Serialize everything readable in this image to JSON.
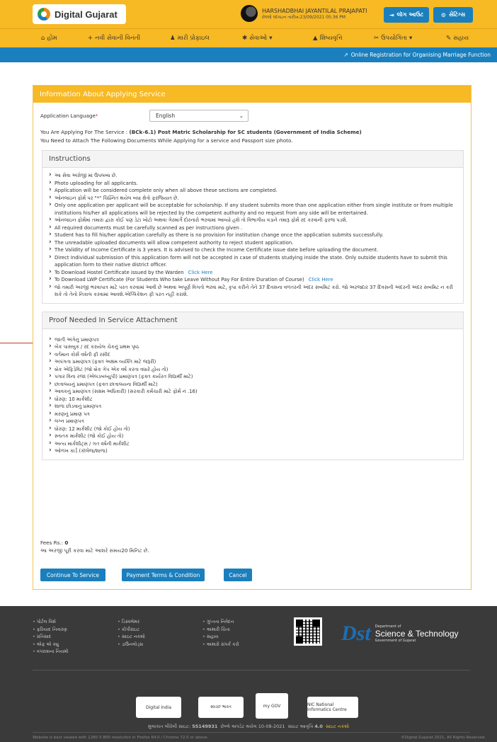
{
  "header": {
    "brand": "Digital Gujarat",
    "user_name": "HARSHADBHAI JAYANTILAL PRAJAPATI",
    "last_login": "છેલ્લો લૉગઇન તારીખ:23/09/2021 05:36 PM",
    "logout_label": "લૉગ આઉટ",
    "settings_label": "સેટિંગ્સ"
  },
  "nav": {
    "home": "હોમ",
    "new_request": "નવી સેવાની વિનંતી",
    "profile": "મારી પ્રોફાઇલ",
    "services": "સેવાઓ",
    "scholarship": "શિષ્યવૃત્તિ",
    "utility": "ઉપયોગિતા",
    "help": "સહાય"
  },
  "bluebar": {
    "link": "Online Registration for Organising Marriage Function"
  },
  "panel": {
    "title": "Information About Applying Service",
    "language_label": "Application Language",
    "language_value": "English",
    "service_prefix": "You Are Applying For The Service : ",
    "service_name": "(BCk-6.1) Post Matric Scholarship for SC students (Government of India Scheme)",
    "attach_note": "You Need to Attach The Following Documents While Applying for a service and Passport size photo."
  },
  "instructions": {
    "title": "Instructions",
    "items": [
      "આ સેવા અંગ્રેજી માં ઉપલબ્ધ છે.",
      "Photo uploading for all applicants.",
      "Application will be considered complete only when all above these sections are completed.",
      "ઓનલાઇન ફોર્મ પર \"*\" ચિહ્નિત થયેલ બધા ક્ષેત્રો ફરજિયાત છે.",
      "Only one application per applicant will be acceptable for scholarship. If any student submits more than one application either from single institute or from multiple institutions his/her all applications will be rejected by the competent authority and no request from any side will be entertained.",
      "ઓનલાઇન ફોર્મમાં તમારા દ્વારા કોઈ પણ ડેટા ખોટો અથવા ગેરમાર્ગે દોરનારો ભરવામાં આવ્યો હશે તો વિભાગીય વડાને તમારૂ ફોર્મ રદ કરવાની ફરજ પડશે.",
      "All required documents must be carefully scanned as per instructions given .",
      "Student has to fill his/her application carefully as there is no provision for institution change once the application submits successfully.",
      "The unreadable uploaded documents will allow competent authority to reject student application.",
      "The Validity of Income Certificate is 3 years. It is advised to check the Income Certificate issue date before uploading the document.",
      "Direct Individual submission of this application form will not be accepted in case of students studying inside the state. Only outside students have to submit this application form to their native district officer."
    ],
    "hostel_text": "To Download Hostel Certificate issued by the Warden",
    "hostel_link": "Click Here",
    "lwp_text": "To Download LWP Certificate (For Students Who take Leave Without Pay For Entire Duration of Course)",
    "lwp_link": "Click Here",
    "last_item": "જો તમારી અરજી ભરવાપાત્ર માટે પરત કરવામાં આવી છે અથવા અપૂર્ણ વિગતો ભરવા માટે, કૃપા કરીને તેને 37 દિવસના વળતરની અંદર સબમિટ કરો. જો અરજદાર 37 દિવસની અંદરની અંદર સબમિટ ન કરી શકે તો તેનો નિકાલ કરવામાં આવશે.એપ્લિકેશન ફી પરત નહીં કરાશે."
  },
  "proof": {
    "title": "Proof Needed In Service Attachment",
    "items": [
      "જાતી અંગેનુ પ્રમાણપત્ર",
      "બેંક પાસબુક / રદ કરાયેલ ચેકનું પ્રથમ પૃષ્ઠ",
      "વર્તમાન કોર્સ વર્ષની ફી રસીદ",
      "અપંગતા પ્રમાણપત્ર (ફક્ત અક્ષમ વ્યક્તિ માટે જરૂરી)",
      "બ્રેક એફિડેવિટ (જો બ્રેક ગેપ એક વર્ષ કરતા વધારે હોય તો)",
      "પગાર વિના રજા (એલડબલ્યુપી) પ્રમાણપત્ર (ફક્ત કાર્યરત વિદ્યાર્થી માટે)",
      "છાત્રાલયનું પ્રમાણપત્ર (ફક્ત છાત્રાલયના વિદ્યાર્થી માટે)",
      "આવકનું પ્રમાણપત્ર (સક્ષમ અધિકારી) (સરકારી કર્મચારી માટે ફોર્મ નં .16)",
      "ધોરણ: 10 માર્કશીટ",
      "શાળા છોડવાનું પ્રમાણપત્ર",
      "મરણનું પ્રમાણ પત્ર",
      "લગ્ન પ્રમાણપત્ર",
      "ધોરણ: 12 માર્કશીટ (જો કોઈ હોય તો)",
      "સ્નાતક માર્કશીટ (જો કોઈ હોય તો)",
      "અન્ય માર્કશીટ્સ / ગત વર્ષની માર્કશીટ",
      "ઓળખ કાર્ડ (કૉલેજ/શાળા)"
    ]
  },
  "fees": {
    "label": "Fees Rs.: ",
    "value": "0",
    "time_note": "આ અરજી પૂરી કરવા માટે આશરે સમય20 મિનિટ છે."
  },
  "buttons": {
    "continue": "Continue To Service",
    "payment": "Payment Terms & Condition",
    "cancel": "Cancel"
  },
  "footer": {
    "col1": [
      "પોર્ટલ વિશે",
      "ફરિયાદ નિવારણ",
      "પ્રતિસાદ",
      "એફ એ ક્યુ",
      "વપરાશના નિયમો"
    ],
    "col2": [
      "ડિસ્ક્લેમર",
      "કોપીરાઇટ",
      "સાઇટ નકશો",
      "ડાઉનલોડ્સ"
    ],
    "col3": [
      "ગુપ્તતા નિવેદન",
      "અમારી ચિંતા",
      "સહાય",
      "અમારો સંપર્ક કરો"
    ],
    "dst_small": "Department of",
    "dst_big": "Science & Technology",
    "dst_gov": "Government of Gujarat",
    "logos": [
      "Digital India",
      "સ્વચ્છ ભારત",
      "my GOV",
      "NIC National Informatics Centre"
    ],
    "visitors_label": "મુલાકાત લીધેલી સાઇટ:",
    "visitors": "55149931",
    "updated": "છેલ્લે અપડેટ થયેલ 10-08-2021",
    "version_label": "સાઇટ આવૃત્તિ",
    "version": "4.0",
    "sitemap": "સાઇટ નકશો",
    "best_viewed": "Website is best viewed with 1280 X 800 resolution in Firefox 64.0 / Chrome 72.0 or above.",
    "copyright": "©Digital Gujarat 2021. All Rights Reserved."
  }
}
